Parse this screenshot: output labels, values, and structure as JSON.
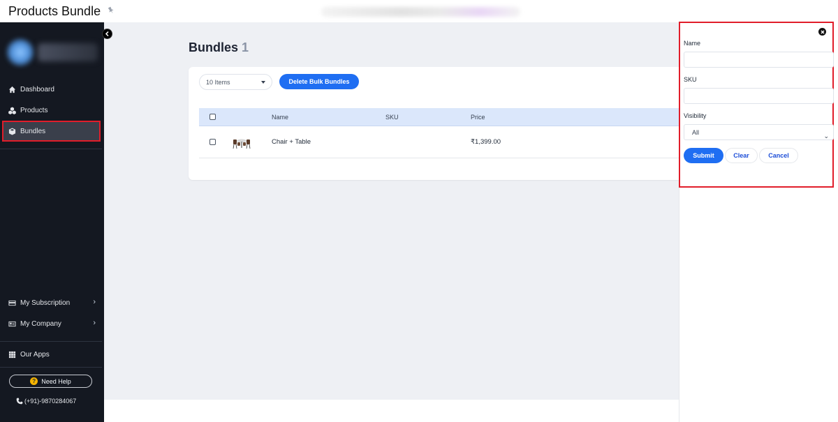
{
  "app": {
    "title": "Products Bundle"
  },
  "sidebar": {
    "nav": [
      {
        "label": "Dashboard",
        "icon": "home-icon"
      },
      {
        "label": "Products",
        "icon": "cubes-icon"
      },
      {
        "label": "Bundles",
        "icon": "cube-icon",
        "active": true
      }
    ],
    "bottom": [
      {
        "label": "My Subscription",
        "icon": "credit-card-icon"
      },
      {
        "label": "My Company",
        "icon": "id-card-icon"
      },
      {
        "label": "Our Apps",
        "icon": "grid-icon"
      }
    ],
    "help_label": "Need Help",
    "phone": "(+91)-9870284067"
  },
  "main": {
    "title": "Bundles",
    "count": "1",
    "items_select": "10 Items",
    "delete_label": "Delete Bulk Bundles",
    "columns": {
      "name": "Name",
      "sku": "SKU",
      "price": "Price"
    },
    "rows": [
      {
        "name": "Chair + Table",
        "sku": "",
        "price": "₹1,399.00"
      }
    ]
  },
  "filter": {
    "name_label": "Name",
    "name_value": "",
    "sku_label": "SKU",
    "sku_value": "",
    "visibility_label": "Visibility",
    "visibility_value": "All",
    "submit_label": "Submit",
    "clear_label": "Clear",
    "cancel_label": "Cancel"
  },
  "colors": {
    "accent": "#1f6ef2",
    "sidebar": "#141821",
    "highlight": "#e11d2a"
  }
}
